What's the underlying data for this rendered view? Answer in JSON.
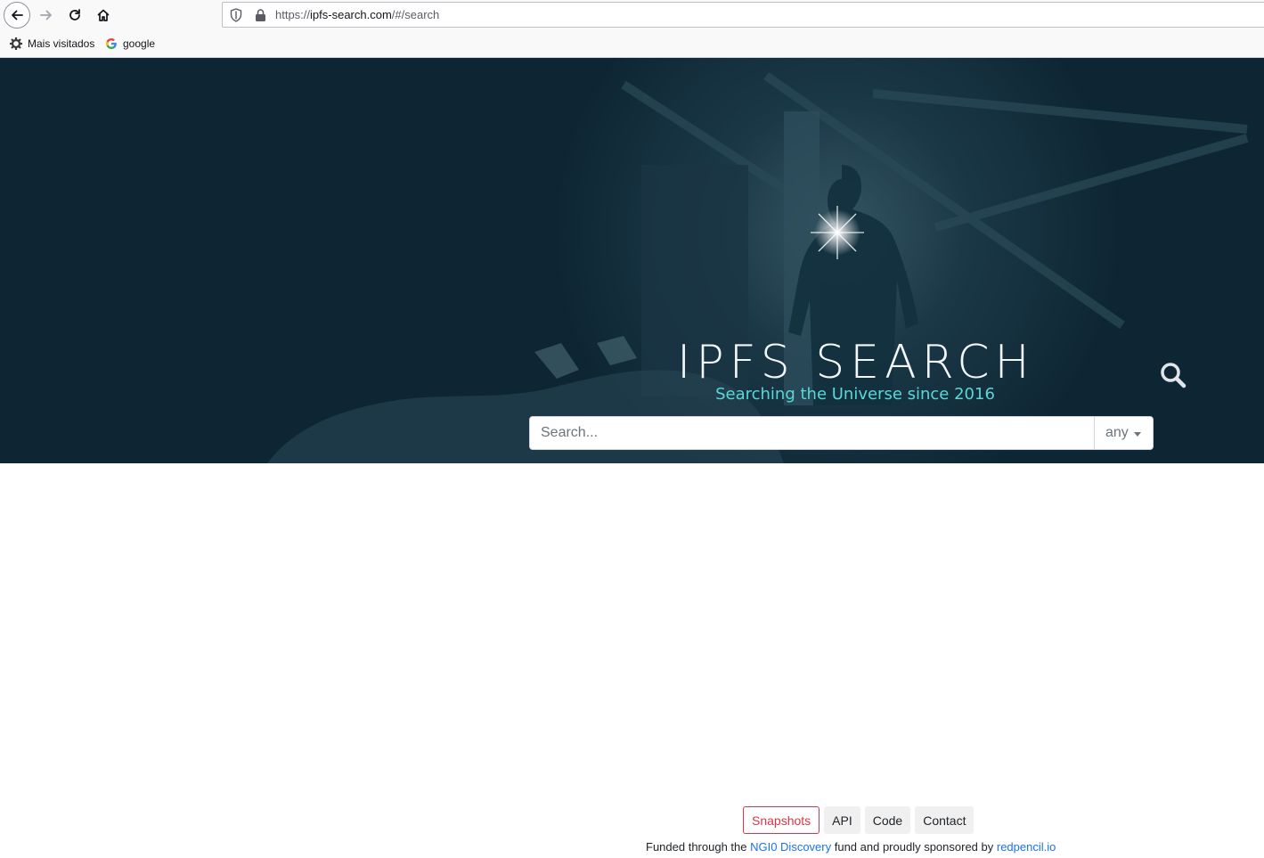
{
  "browser": {
    "url_prefix": "https://",
    "url_host": "ipfs-search.com",
    "url_path": "/#/search",
    "bookmarks": [
      {
        "label": "Mais visitados",
        "icon": "gear-icon"
      },
      {
        "label": "google",
        "icon": "google-icon"
      }
    ]
  },
  "hero": {
    "title": "IPFS SEARCH",
    "tagline": "Searching the Universe since 2016"
  },
  "search": {
    "placeholder": "Search...",
    "type_value": "any"
  },
  "footer": {
    "nav": [
      {
        "label": "Snapshots",
        "active": true
      },
      {
        "label": "API"
      },
      {
        "label": "Code"
      },
      {
        "label": "Contact"
      }
    ],
    "funded_prefix": "Funded through the ",
    "ngi_link": "NGI0 Discovery",
    "funded_middle": " fund and proudly sponsored by ",
    "sponsor_link": "redpencil.io"
  },
  "colors": {
    "hero_bg": "#0e2634",
    "tagline": "#5ad8d8",
    "active_nav": "#dc3545",
    "link": "#1a73e8"
  }
}
